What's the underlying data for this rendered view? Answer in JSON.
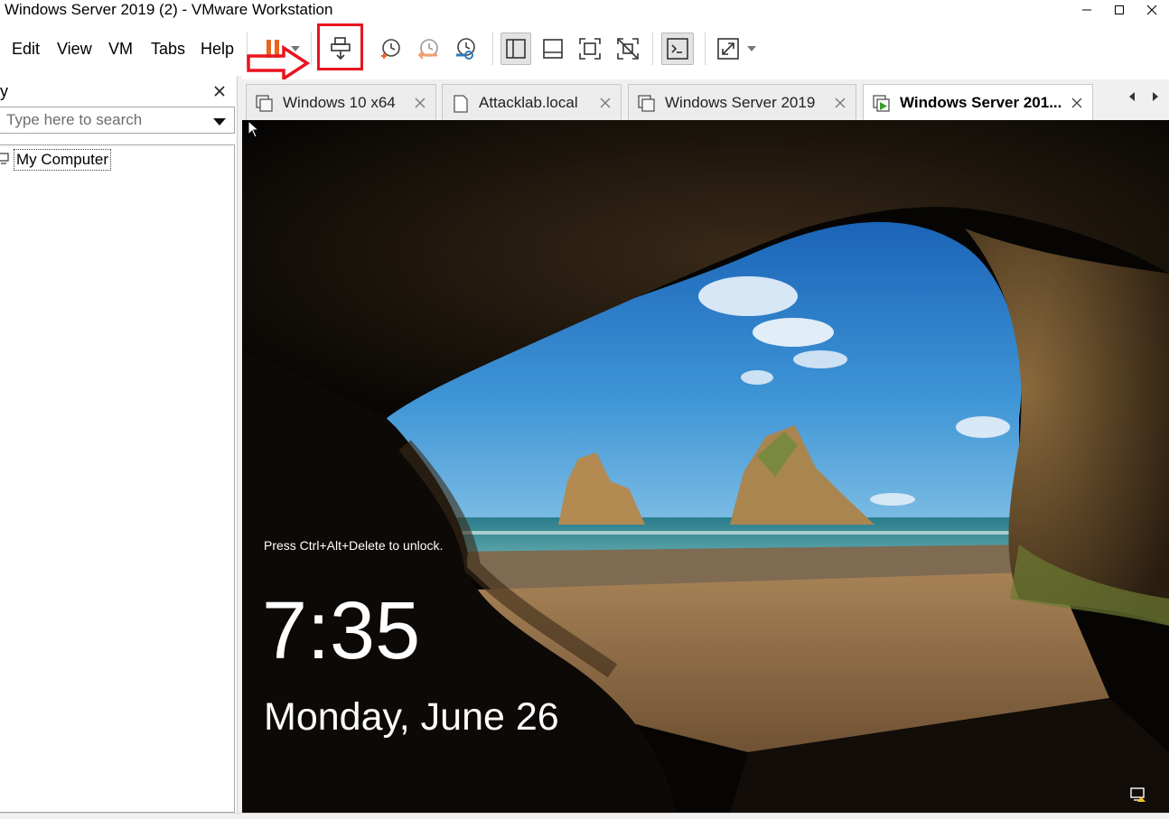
{
  "window": {
    "title": "Windows Server 2019 (2) - VMware Workstation",
    "controls": [
      "minimize-icon",
      "maximize-icon",
      "close-icon"
    ]
  },
  "menu": {
    "items": [
      "Edit",
      "View",
      "VM",
      "Tabs",
      "Help"
    ]
  },
  "toolbar": {
    "buttons": [
      "power-pause-icon",
      "dropdown-arrow-icon",
      "send-ctrl-alt-del-icon",
      "snapshot-icon",
      "revert-snapshot-icon",
      "snapshot-manager-icon",
      "show-library-icon",
      "show-thumbnail-bar-icon",
      "full-screen-icon",
      "unity-icon",
      "console-view-icon",
      "stretch-guest-icon",
      "stretch-dropdown-icon"
    ],
    "accent_colors": {
      "power": "#e8651e",
      "snapshot_revert": "#f0a070",
      "snapshot_manager": "#2a7bbf",
      "annotation_red": "#e8141e"
    }
  },
  "library": {
    "title_fragment": "y",
    "search_placeholder": "Type here to search",
    "tree": [
      {
        "label": "My Computer",
        "icon": "computer-icon"
      }
    ]
  },
  "tabs": [
    {
      "label": "Windows 10 x64",
      "icon": "vm-icon",
      "active": false
    },
    {
      "label": "Attacklab.local",
      "icon": "document-icon",
      "active": false
    },
    {
      "label": "Windows Server 2019",
      "icon": "vm-icon",
      "active": false
    },
    {
      "label": "Windows Server 201...",
      "icon": "vm-running-icon",
      "active": true
    }
  ],
  "vm_screen": {
    "lock_hint": "Press Ctrl+Alt+Delete to unlock.",
    "time": "7:35",
    "date": "Monday, June 26",
    "tray_icon": "network-icon"
  },
  "annotations": {
    "highlighted_button": "send-ctrl-alt-del-icon",
    "arrow": "right-arrow-annotation"
  }
}
